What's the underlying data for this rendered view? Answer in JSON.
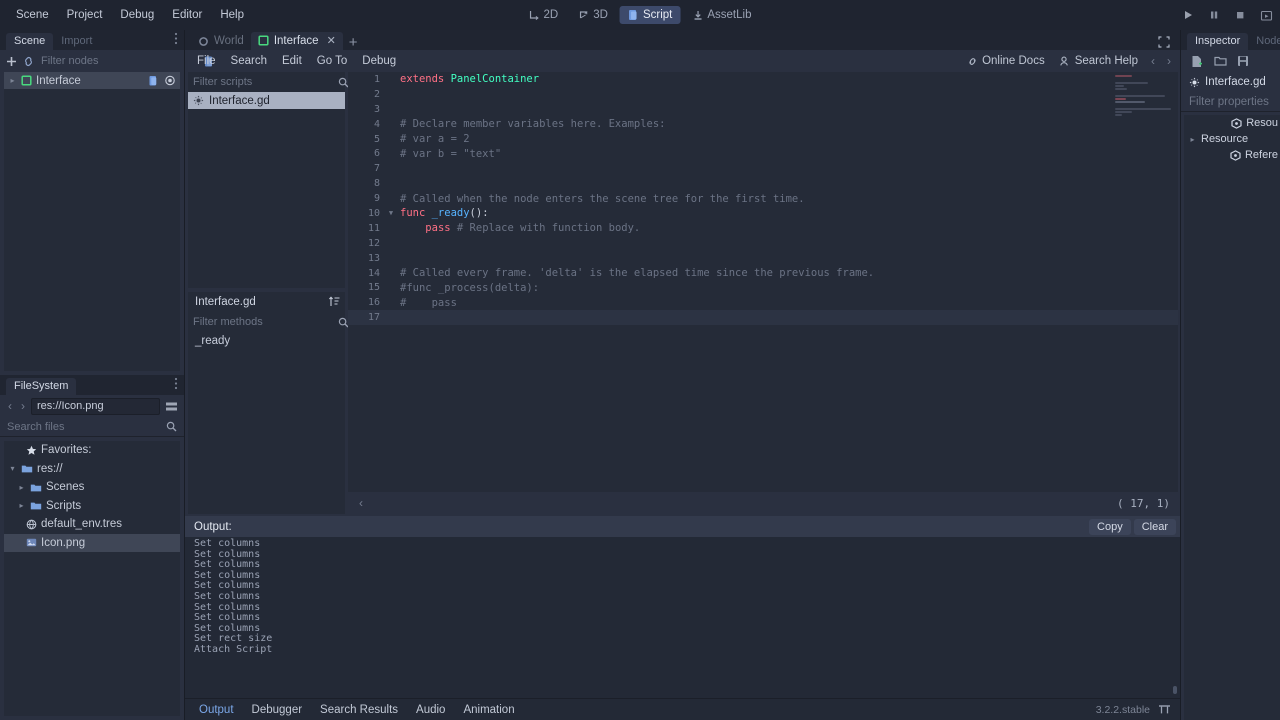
{
  "menubar": {
    "items": [
      "Scene",
      "Project",
      "Debug",
      "Editor",
      "Help"
    ],
    "modes": [
      {
        "label": "2D",
        "icon": "2d-icon",
        "active": false
      },
      {
        "label": "3D",
        "icon": "3d-icon",
        "active": false
      },
      {
        "label": "Script",
        "icon": "script-icon",
        "active": true
      },
      {
        "label": "AssetLib",
        "icon": "assetlib-icon",
        "active": false
      }
    ],
    "playback": [
      "play-icon",
      "pause-icon",
      "stop-icon",
      "play-custom-scene-icon"
    ]
  },
  "left_dock": {
    "tabs": [
      {
        "label": "Scene",
        "active": true
      },
      {
        "label": "Import",
        "active": false
      }
    ],
    "scene": {
      "filter_placeholder": "Filter nodes",
      "nodes": [
        {
          "label": "Interface",
          "selected": true,
          "expandable": true
        }
      ]
    },
    "filesystem": {
      "title": "FileSystem",
      "path": "res://Icon.png",
      "search_placeholder": "Search files",
      "items": [
        {
          "label": "Favorites:",
          "icon": "star-icon",
          "depth": 0,
          "selected": false,
          "arrow": ""
        },
        {
          "label": "res://",
          "icon": "folder-icon",
          "depth": 0,
          "selected": false,
          "arrow": "v"
        },
        {
          "label": "Scenes",
          "icon": "folder-icon",
          "depth": 1,
          "selected": false,
          "arrow": ">"
        },
        {
          "label": "Scripts",
          "icon": "folder-icon",
          "depth": 1,
          "selected": false,
          "arrow": ">"
        },
        {
          "label": "default_env.tres",
          "icon": "resource-icon",
          "depth": 1,
          "selected": false,
          "arrow": ""
        },
        {
          "label": "Icon.png",
          "icon": "image-icon",
          "depth": 1,
          "selected": true,
          "arrow": ""
        }
      ]
    }
  },
  "script_editor": {
    "tabs": [
      {
        "label": "World",
        "icon": "node-circle-icon",
        "active": false,
        "closable": false
      },
      {
        "label": "Interface",
        "icon": "panel-square-icon",
        "active": true,
        "closable": true
      }
    ],
    "add_tab_label": "+",
    "close_label": "✕",
    "menus": [
      "File",
      "Search",
      "Edit",
      "Go To",
      "Debug"
    ],
    "help_buttons": [
      {
        "label": "Online Docs",
        "icon": "link-icon"
      },
      {
        "label": "Search Help",
        "icon": "docsearch-icon"
      }
    ],
    "nav_prev": "‹",
    "nav_next": "›",
    "scripts_filter_placeholder": "Filter scripts",
    "scripts": [
      {
        "label": "Interface.gd",
        "selected": true,
        "icon": "gdscript-icon"
      }
    ],
    "members_header": "Interface.gd",
    "methods_filter_placeholder": "Filter methods",
    "methods": [
      "_ready"
    ],
    "status_left": "‹",
    "status_position": "( 17,   1)",
    "code_lines": [
      {
        "n": 1,
        "fold": "",
        "tokens": [
          {
            "t": "extends ",
            "c": "k-kw"
          },
          {
            "t": "PanelContainer",
            "c": "k-type"
          }
        ]
      },
      {
        "n": 2,
        "fold": "",
        "tokens": []
      },
      {
        "n": 3,
        "fold": "",
        "tokens": []
      },
      {
        "n": 4,
        "fold": "",
        "tokens": [
          {
            "t": "# Declare member variables here. Examples:",
            "c": "k-com"
          }
        ]
      },
      {
        "n": 5,
        "fold": "",
        "tokens": [
          {
            "t": "# var a = 2",
            "c": "k-com"
          }
        ]
      },
      {
        "n": 6,
        "fold": "",
        "tokens": [
          {
            "t": "# var b = \"text\"",
            "c": "k-com"
          }
        ]
      },
      {
        "n": 7,
        "fold": "",
        "tokens": []
      },
      {
        "n": 8,
        "fold": "",
        "tokens": []
      },
      {
        "n": 9,
        "fold": "",
        "tokens": [
          {
            "t": "# Called when the node enters the scene tree for the first time.",
            "c": "k-com"
          }
        ]
      },
      {
        "n": 10,
        "fold": "v",
        "tokens": [
          {
            "t": "func ",
            "c": "k-kw"
          },
          {
            "t": "_ready",
            "c": "k-fn"
          },
          {
            "t": "():",
            "c": ""
          }
        ]
      },
      {
        "n": 11,
        "fold": "",
        "tokens": [
          {
            "t": "    ",
            "c": ""
          },
          {
            "t": "pass",
            "c": "k-kw"
          },
          {
            "t": " # Replace with function body.",
            "c": "k-com"
          }
        ]
      },
      {
        "n": 12,
        "fold": "",
        "tokens": []
      },
      {
        "n": 13,
        "fold": "",
        "tokens": []
      },
      {
        "n": 14,
        "fold": "",
        "tokens": [
          {
            "t": "# Called every frame. 'delta' is the elapsed time since the previous frame.",
            "c": "k-com"
          }
        ]
      },
      {
        "n": 15,
        "fold": "",
        "tokens": [
          {
            "t": "#func _process(delta):",
            "c": "k-com"
          }
        ]
      },
      {
        "n": 16,
        "fold": "",
        "tokens": [
          {
            "t": "#    pass",
            "c": "k-com"
          }
        ]
      },
      {
        "n": 17,
        "fold": "",
        "tokens": [],
        "current": true
      }
    ]
  },
  "output_panel": {
    "title": "Output:",
    "buttons": [
      "Copy",
      "Clear"
    ],
    "lines": [
      "Set columns",
      "Set columns",
      "Set columns",
      "Set columns",
      "Set columns",
      "Set columns",
      "Set columns",
      "Set columns",
      "Set columns",
      "Set rect size",
      "Attach Script"
    ]
  },
  "statusbar": {
    "tabs": [
      {
        "label": "Output",
        "active": true
      },
      {
        "label": "Debugger",
        "active": false
      },
      {
        "label": "Search Results",
        "active": false
      },
      {
        "label": "Audio",
        "active": false
      },
      {
        "label": "Animation",
        "active": false
      }
    ],
    "version": "3.2.2.stable",
    "right_icon": "layout-icon"
  },
  "inspector": {
    "tabs": [
      {
        "label": "Inspector",
        "active": true
      },
      {
        "label": "Node",
        "active": false
      }
    ],
    "toolbar_icons": [
      "new-resource-icon",
      "load-resource-icon",
      "save-resource-icon"
    ],
    "resource_name": "Interface.gd",
    "filter_placeholder": "Filter properties",
    "properties": [
      {
        "label": "Resou",
        "icon": "class-icon",
        "indent": true
      },
      {
        "label": "Resource",
        "icon": "",
        "indent": false,
        "arrow": ">"
      },
      {
        "label": "Refere",
        "icon": "class-icon",
        "indent": true
      }
    ]
  },
  "colors": {
    "accent": "#5a7fc4",
    "panel_bg": "#2a3040",
    "window_bg": "#202531",
    "tree_bg": "#252b38",
    "selection": "#3f4656",
    "keyword": "#ff7085",
    "type": "#42ffc2",
    "function": "#57b3ff",
    "comment": "#6b7385",
    "string": "#ffeda1"
  }
}
